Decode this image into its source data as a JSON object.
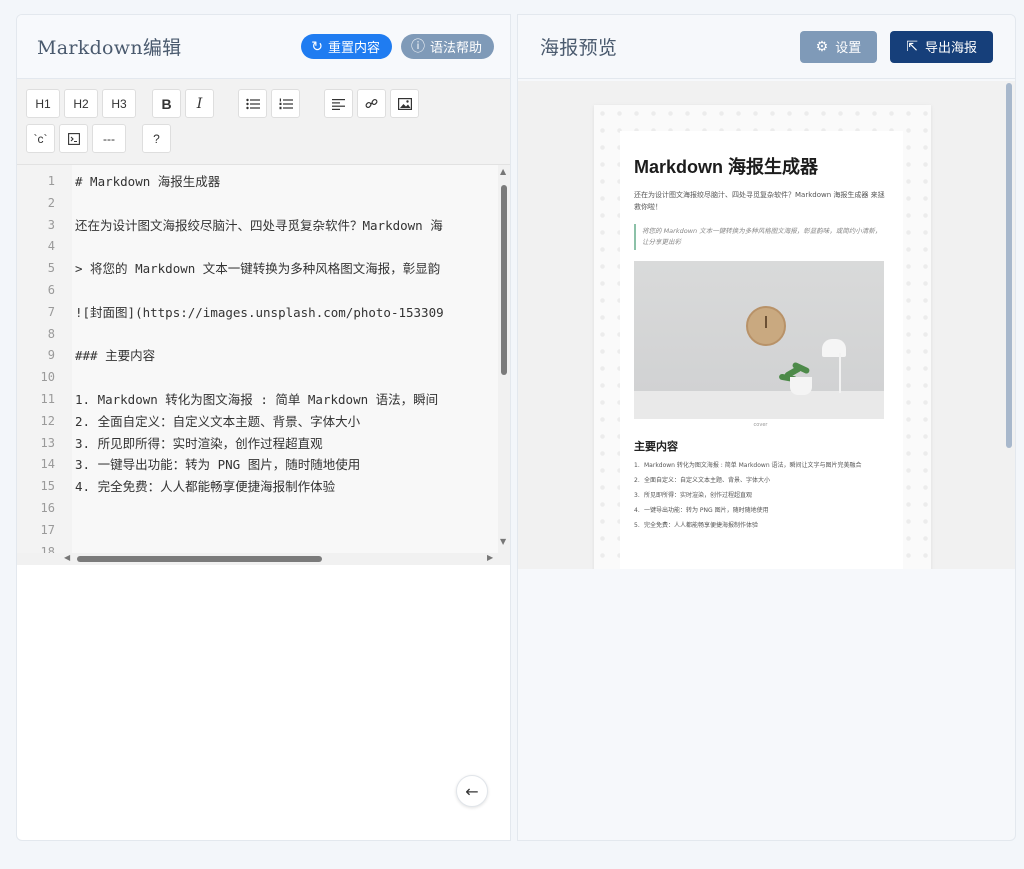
{
  "left": {
    "title": "Markdown编辑",
    "reset_label": "重置内容",
    "help_label": "语法帮助",
    "toolbar": {
      "h1": "H1",
      "h2": "H2",
      "h3": "H3",
      "bold": "B",
      "italic": "I",
      "code": "`c`",
      "terminal": "⊡",
      "hr": "---",
      "help": "?"
    },
    "lines": [
      {
        "n": "1",
        "text": "#  Markdown 海报生成器"
      },
      {
        "n": "2",
        "text": ""
      },
      {
        "n": "3",
        "text": "还在为设计图文海报绞尽脑汁、四处寻觅复杂软件？Markdown 海"
      },
      {
        "n": "4",
        "text": ""
      },
      {
        "n": "5",
        "text": "> 将您的 Markdown 文本一键转换为多种风格图文海报，彰显韵"
      },
      {
        "n": "6",
        "text": ""
      },
      {
        "n": "7",
        "text": "![封面图](https://images.unsplash.com/photo-153309"
      },
      {
        "n": "8",
        "text": ""
      },
      {
        "n": "9",
        "text": "### 主要内容"
      },
      {
        "n": "10",
        "text": ""
      },
      {
        "n": "11",
        "text": "1. Markdown 转化为图文海报 : 简单 Markdown 语法，瞬间"
      },
      {
        "n": "12",
        "text": "2. 全面自定义：自定义文本主题、背景、字体大小"
      },
      {
        "n": "13",
        "text": "3. 所见即所得：实时渲染，创作过程超直观"
      },
      {
        "n": "14",
        "text": "3. 一键导出功能：转为 PNG 图片，随时随地使用"
      },
      {
        "n": "15",
        "text": "4. 完全免费：人人都能畅享便捷海报制作体验"
      },
      {
        "n": "16",
        "text": ""
      },
      {
        "n": "17",
        "text": ""
      },
      {
        "n": "18",
        "text": ""
      }
    ]
  },
  "right": {
    "title": "海报预览",
    "settings_label": "设置",
    "export_label": "导出海报",
    "poster": {
      "title": "Markdown 海报生成器",
      "intro": "还在为设计图文海报绞尽脑汁、四处寻觅复杂软件？Markdown 海报生成器 来拯救你啦！",
      "quote": "将您的 Markdown 文本一键转换为多种风格图文海报，彰显韵味，或简约小清新，让分享更出彩",
      "caption": "cover",
      "section": "主要内容",
      "items": [
        "Markdown 转化为图文海报 : 简单 Markdown 语法，瞬间让文字与图片完美融合",
        "全面自定义：自定义文本主题、背景、字体大小",
        "所见即所得：实时渲染，创作过程超直观",
        "一键导出功能：转为 PNG 图片，随时随地使用",
        "完全免费：人人都能畅享便捷海报制作体验"
      ]
    }
  }
}
